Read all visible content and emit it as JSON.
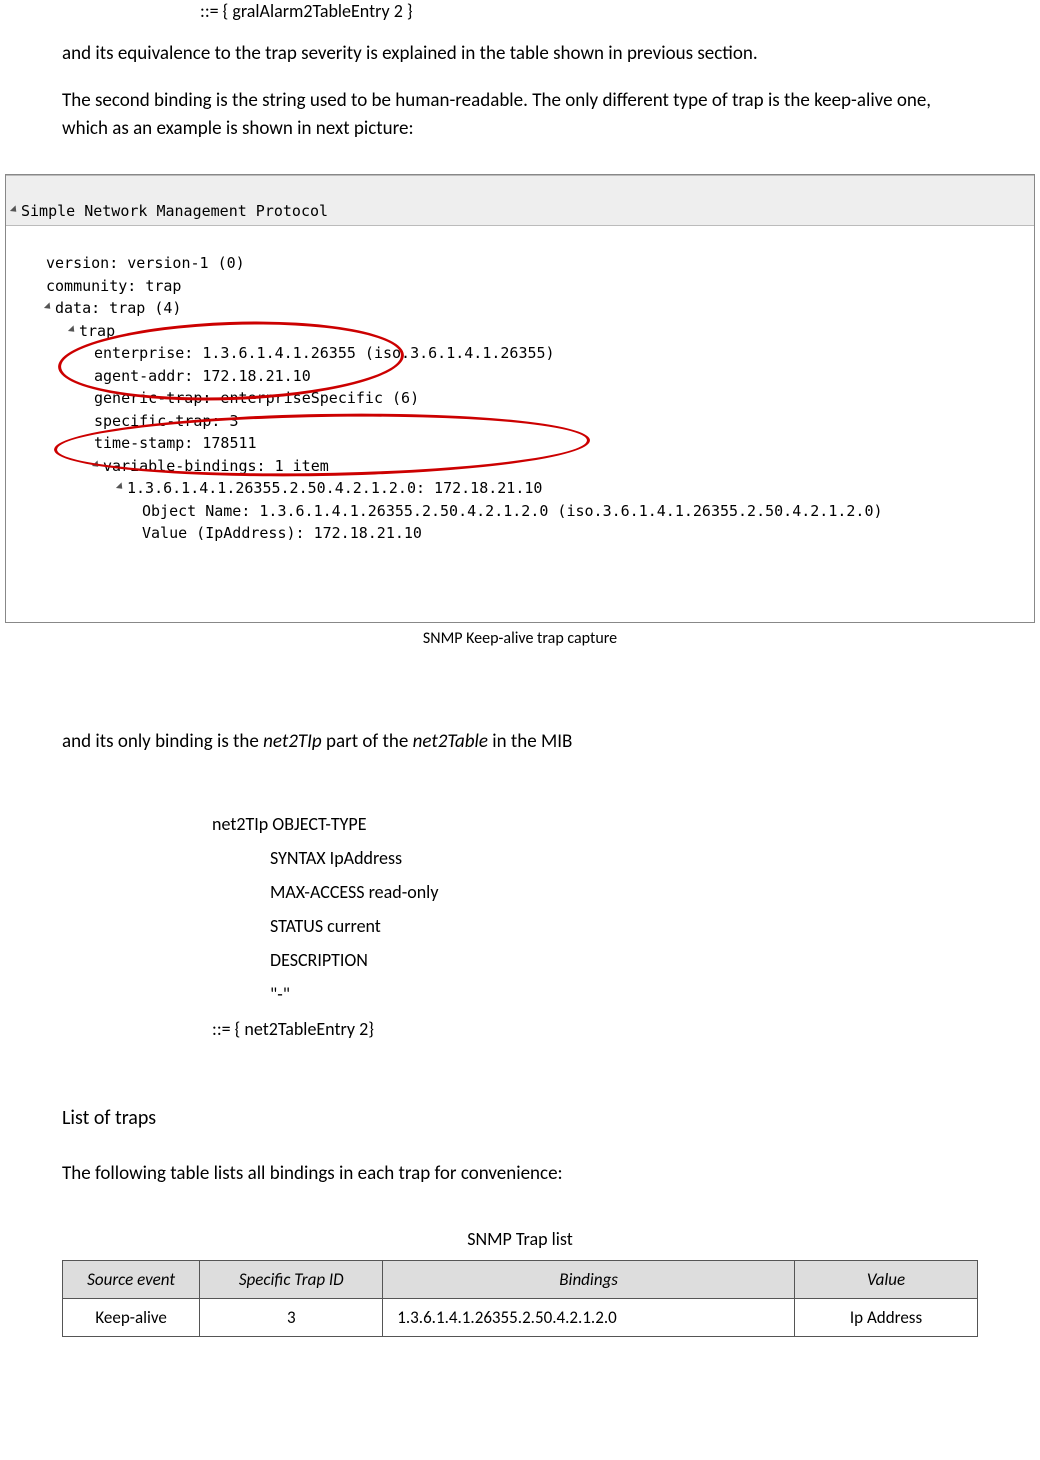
{
  "top_code": "::= { gralAlarm2TableEntry 2 }",
  "para1": "and its equivalence to the trap severity is explained in the table shown in previous section.",
  "para2": "The second binding is the string used to be human-readable. The only different type of trap is the keep-alive one, which as an example is shown in next picture:",
  "capture": {
    "title": "Simple Network Management Protocol",
    "lines": [
      "version: version-1 (0)",
      "community: trap",
      "data: trap (4)",
      "trap",
      "enterprise: 1.3.6.1.4.1.26355 (iso.3.6.1.4.1.26355)",
      "agent-addr: 172.18.21.10",
      "generic-trap: enterpriseSpecific (6)",
      "specific-trap: 3",
      "time-stamp: 178511",
      "variable-bindings: 1 item",
      "1.3.6.1.4.1.26355.2.50.4.2.1.2.0: 172.18.21.10",
      "Object Name: 1.3.6.1.4.1.26355.2.50.4.2.1.2.0 (iso.3.6.1.4.1.26355.2.50.4.2.1.2.0)",
      "Value (IpAddress): 172.18.21.10"
    ],
    "caption": "SNMP Keep-alive trap capture"
  },
  "para3_pre": "and its only binding is the ",
  "para3_em1": "net2TIp",
  "para3_mid": " part of the ",
  "para3_em2": "net2Table",
  "para3_post": " in the MIB",
  "mib": {
    "l1": "net2TIp OBJECT-TYPE",
    "l2": "SYNTAX IpAddress",
    "l3": "MAX-ACCESS read-only",
    "l4": "STATUS current",
    "l5": "DESCRIPTION",
    "l6": "\"-\"",
    "l7": "::= { net2TableEntry 2}"
  },
  "heading": "List of traps",
  "para4": "The following table lists all bindings in each trap for convenience:",
  "table": {
    "caption": "SNMP Trap list",
    "headers": [
      "Source event",
      "Specific Trap ID",
      "Bindings",
      "Value"
    ],
    "rows": [
      [
        "Keep-alive",
        "3",
        "1.3.6.1.4.1.26355.2.50.4.2.1.2.0",
        "Ip Address"
      ]
    ]
  }
}
